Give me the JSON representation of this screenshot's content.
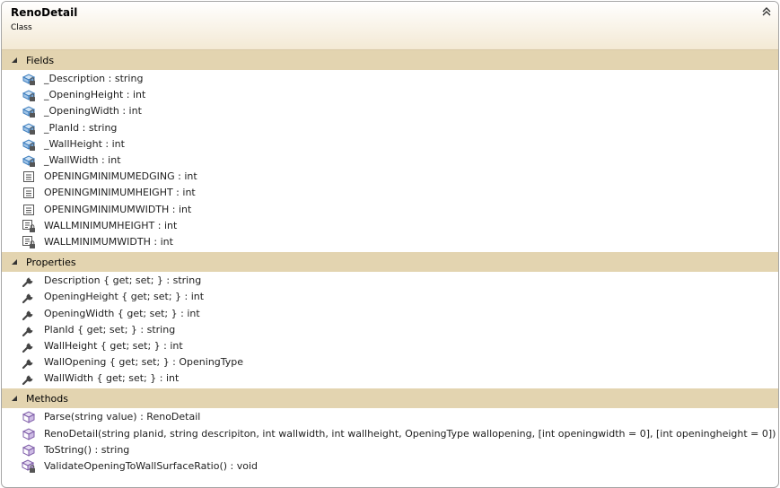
{
  "header": {
    "class_name": "RenoDetail",
    "class_kind": "Class",
    "collapse_icon": "double-chevron-up-icon"
  },
  "colors": {
    "section_bg": "#e3d4b0",
    "header_gradient_end": "#f3e9d4",
    "field_icon_blue": "#3f7fbf",
    "method_icon_purple": "#7e5ca8"
  },
  "sections": {
    "fields": {
      "label": "Fields",
      "items": [
        {
          "text": "_Description : string",
          "icon": "private-field-icon"
        },
        {
          "text": "_OpeningHeight : int",
          "icon": "private-field-icon"
        },
        {
          "text": "_OpeningWidth : int",
          "icon": "private-field-icon"
        },
        {
          "text": "_PlanId : string",
          "icon": "private-field-icon"
        },
        {
          "text": "_WallHeight : int",
          "icon": "private-field-icon"
        },
        {
          "text": "_WallWidth : int",
          "icon": "private-field-icon"
        },
        {
          "text": "OPENINGMINIMUMEDGING : int",
          "icon": "constant-icon"
        },
        {
          "text": "OPENINGMINIMUMHEIGHT : int",
          "icon": "constant-icon"
        },
        {
          "text": "OPENINGMINIMUMWIDTH : int",
          "icon": "constant-icon"
        },
        {
          "text": "WALLMINIMUMHEIGHT : int",
          "icon": "private-constant-icon"
        },
        {
          "text": "WALLMINIMUMWIDTH : int",
          "icon": "private-constant-icon"
        }
      ]
    },
    "properties": {
      "label": "Properties",
      "items": [
        {
          "text": "Description { get; set; } : string",
          "icon": "property-wrench-icon"
        },
        {
          "text": "OpeningHeight { get; set; } : int",
          "icon": "property-wrench-icon"
        },
        {
          "text": "OpeningWidth { get; set; } : int",
          "icon": "property-wrench-icon"
        },
        {
          "text": "PlanId { get; set; } : string",
          "icon": "property-wrench-icon"
        },
        {
          "text": "WallHeight { get; set; } : int",
          "icon": "property-wrench-icon"
        },
        {
          "text": "WallOpening { get; set; } : OpeningType",
          "icon": "property-wrench-icon"
        },
        {
          "text": "WallWidth { get; set; } : int",
          "icon": "property-wrench-icon"
        }
      ]
    },
    "methods": {
      "label": "Methods",
      "items": [
        {
          "text": "Parse(string value) : RenoDetail",
          "icon": "method-cube-icon"
        },
        {
          "text": "RenoDetail(string planid, string descripiton, int wallwidth, int wallheight, OpeningType wallopening, [int openingwidth = 0], [int openingheight = 0])",
          "icon": "method-cube-icon"
        },
        {
          "text": "ToString() : string",
          "icon": "method-cube-icon"
        },
        {
          "text": "ValidateOpeningToWallSurfaceRatio() : void",
          "icon": "private-method-icon"
        }
      ]
    }
  }
}
